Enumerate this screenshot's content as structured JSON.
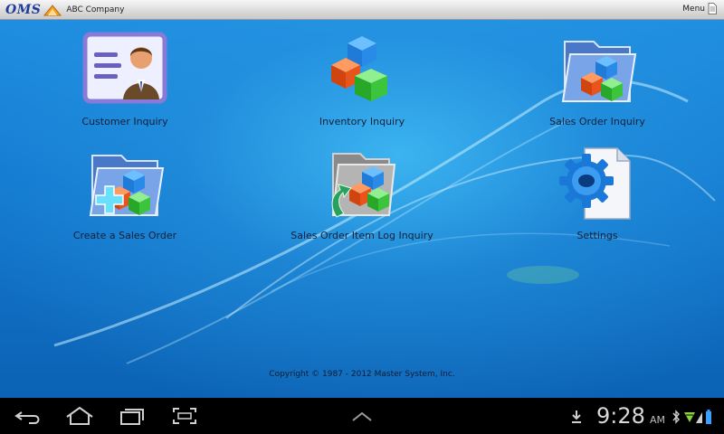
{
  "topbar": {
    "app_logo": "OMS",
    "company": "ABC Company",
    "menu_label": "Menu"
  },
  "tiles": [
    {
      "label": "Customer Inquiry",
      "icon": "customer-card-icon"
    },
    {
      "label": "Inventory Inquiry",
      "icon": "colored-cubes-icon"
    },
    {
      "label": "Sales Order Inquiry",
      "icon": "folder-cubes-icon"
    },
    {
      "label": "Create a Sales Order",
      "icon": "folder-cubes-plus-icon"
    },
    {
      "label": "Sales Order Item Log Inquiry",
      "icon": "log-folder-cubes-icon"
    },
    {
      "label": "Settings",
      "icon": "gear-document-icon"
    }
  ],
  "footer": {
    "copyright": "Copyright © 1987 - 2012 Master System, Inc."
  },
  "system_bar": {
    "time": "9:28",
    "ampm": "AM"
  },
  "colors": {
    "desktop_blue": "#137ad0",
    "logo_blue": "#1e3c9a",
    "cube_blue": "#2a8ae8",
    "cube_red": "#e8541c",
    "cube_green": "#3cc43c"
  }
}
